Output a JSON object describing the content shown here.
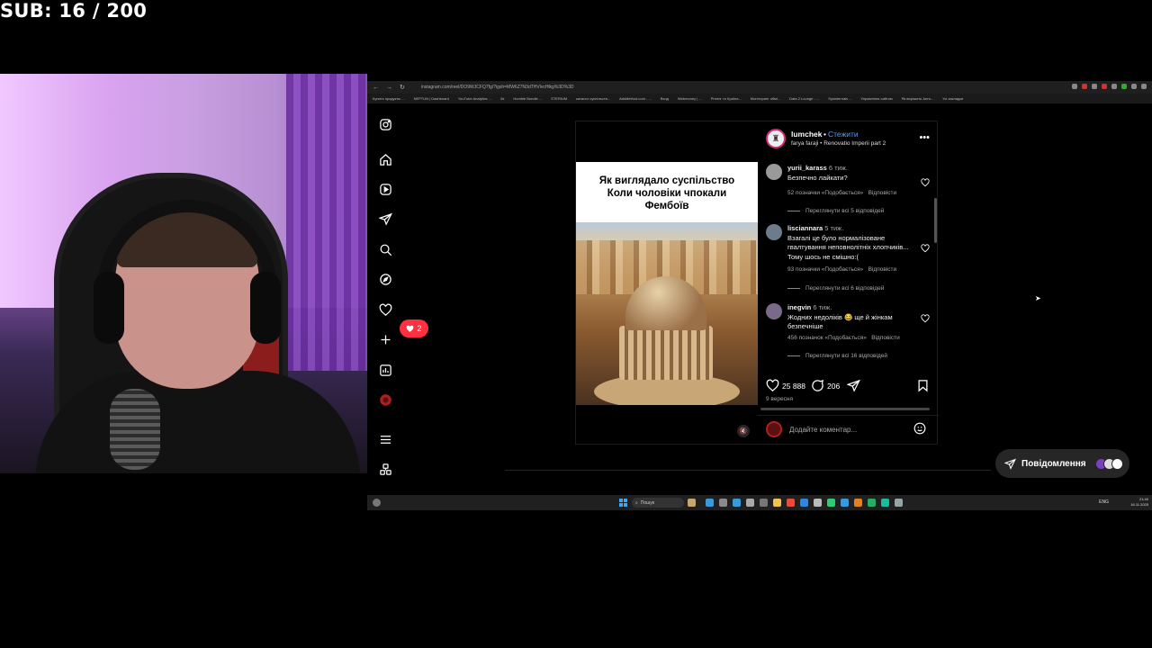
{
  "overlay": {
    "sub_counter": "SUB: 16 / 200"
  },
  "browser": {
    "url": "instagram.com/reel/DO9WJCFQ7fg/?igsh=MW6Z7N3dTHVlvcHlkg%3D%3D",
    "bookmarks": [
      "Купить продукты ...",
      "NEPTUN | Dashboard",
      "YouTube Analytics ...",
      "3d",
      "Humble Bundle ...",
      "STERIUM",
      "каталог суспільств...",
      "AdsMethod.com - ...",
      "Вход",
      "Webmoney | ...",
      "Рітлінг то Країна...",
      "Моніторинг обмі...",
      "Data 2 Lounge - ...",
      "Sysinternals ...",
      "Управління сайтом",
      "Як вирішить Акти...",
      "Усі закладки"
    ]
  },
  "sidebar": {
    "icons": [
      "instagram-icon",
      "home-icon",
      "reels-icon",
      "direct-icon",
      "search-icon",
      "explore-icon",
      "heart-icon",
      "create-icon",
      "dashboard-icon",
      "profile-icon",
      "menu-icon",
      "threads-icon"
    ],
    "notification_count": "2"
  },
  "post": {
    "author": "lumchek",
    "dot": "•",
    "follow_label": "Стежити",
    "audio": "farya faraji • Renovatio Imperii part 2",
    "caption_lines": [
      "Як виглядало суспільство",
      "Коли чоловіки чпокали",
      "Фембоїв"
    ],
    "likes": "25 888",
    "comments_count": "206",
    "date": "9 вересня",
    "comment_placeholder": "Додайте коментар..."
  },
  "comments": [
    {
      "user": "yurii_karass",
      "time": "6 тиж.",
      "text": "Безпечно лайкати?",
      "likes": "52 позначки «Подобається»",
      "reply_label": "Відповісти",
      "view_replies": "Переглянути всі 5 відповідей"
    },
    {
      "user": "lisciannara",
      "time": "5 тиж.",
      "text": "Взагалі це було нормалізоване гвалтування неповнолітніх хлопчиків... Тому шось не смішно:(",
      "likes": "93 позначки «Подобається»",
      "reply_label": "Відповісти",
      "view_replies": "Переглянути всі 6 відповідей"
    },
    {
      "user": "inegvin",
      "time": "6 тиж.",
      "text": "Жодних недоліків 😂 ще й жінкам безпечніше",
      "likes": "456 позначок «Подобається»",
      "reply_label": "Відповісти",
      "view_replies": "Переглянути всі 16 відповідей"
    }
  ],
  "messages": {
    "label": "Повідомлення"
  },
  "taskbar": {
    "search_label": "Пошук",
    "tray": "ENG",
    "clock_time": "21:40",
    "clock_date": "16.11.2025"
  },
  "colors": {
    "follow_blue": "#4aa3ff",
    "notification_red": "#ff3040",
    "background": "#000000"
  }
}
